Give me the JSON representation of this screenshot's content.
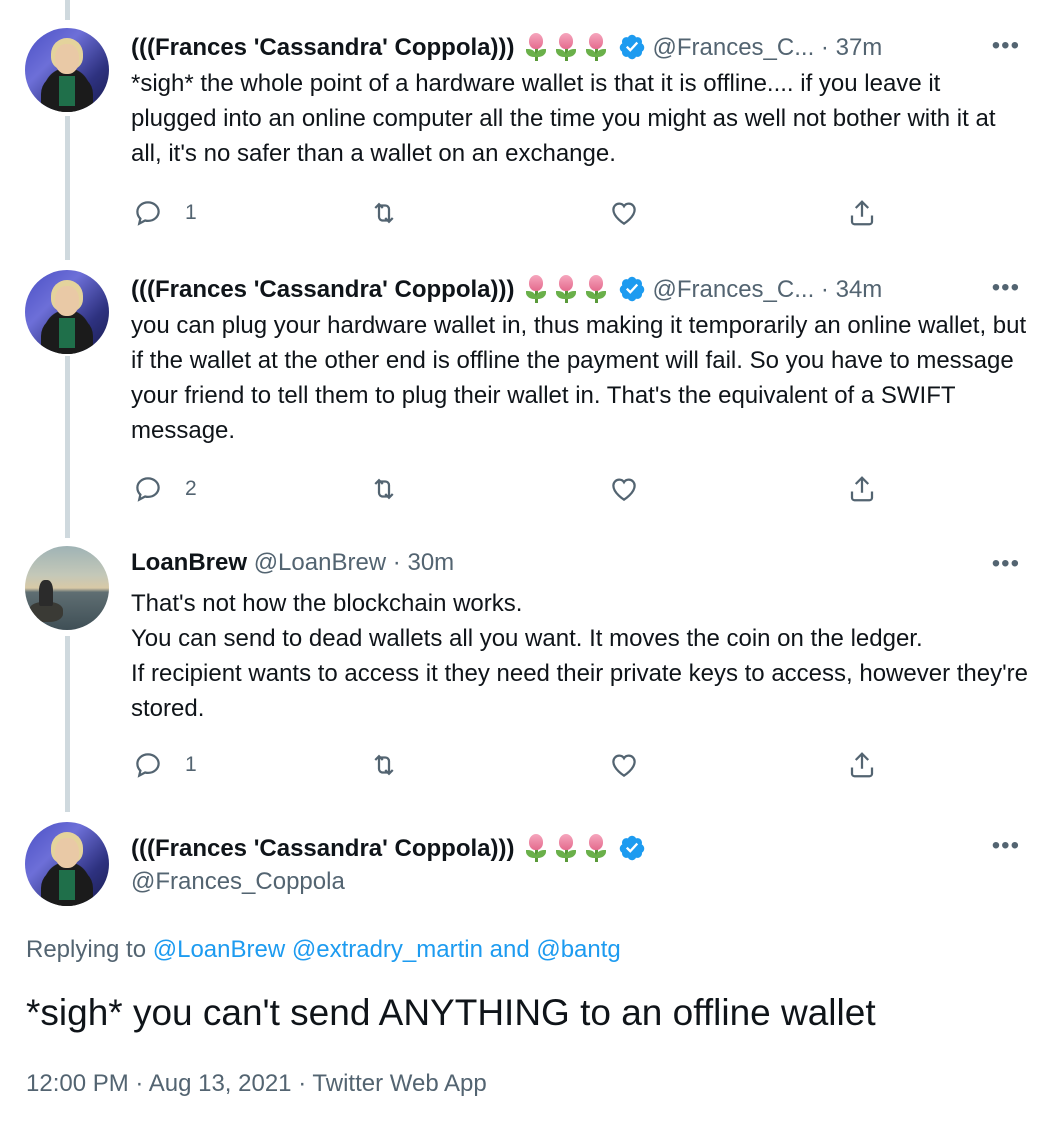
{
  "tweets": [
    {
      "name": "(((Frances 'Cassandra' Coppola)))",
      "handle": "@Frances_C...",
      "sep": "·",
      "time": "37m",
      "text": "*sigh* the whole point of a hardware wallet is that it is offline.... if you leave it plugged into an online computer all the time you might as well not bother with it at all, it's no safer than a wallet on an exchange.",
      "reply_count": "1"
    },
    {
      "name": "(((Frances 'Cassandra' Coppola)))",
      "handle": "@Frances_C...",
      "sep": "·",
      "time": "34m",
      "text": "you can plug your hardware wallet in, thus making it temporarily an online wallet, but if the wallet at the other end is offline the payment will fail. So you have to message your friend to tell them to plug their wallet in. That's the equivalent of a SWIFT message.",
      "reply_count": "2"
    },
    {
      "name": "LoanBrew",
      "handle": "@LoanBrew",
      "sep": "·",
      "time": "30m",
      "text_lines": [
        "That's not how the blockchain works.",
        "You can send to dead wallets all you want. It moves the coin on the ledger.",
        "If recipient wants to access it they need their private keys to access, however they're stored."
      ],
      "reply_count": "1"
    }
  ],
  "main_tweet": {
    "name": "(((Frances 'Cassandra' Coppola)))",
    "handle": "@Frances_Coppola",
    "replying_prefix": "Replying to",
    "replying_user1": "@LoanBrew",
    "replying_user2": "@extradry_martin",
    "replying_and": "and",
    "replying_user3": "@bantg",
    "text": "*sigh* you can't send ANYTHING to an offline wallet",
    "meta": "12:00 PM · Aug 13, 2021 · Twitter Web App"
  },
  "more_label": "•••",
  "colors": {
    "link": "#1d9bf0",
    "muted": "#536471",
    "verified": "#1d9bf0",
    "thread_line": "#cfd9de"
  }
}
